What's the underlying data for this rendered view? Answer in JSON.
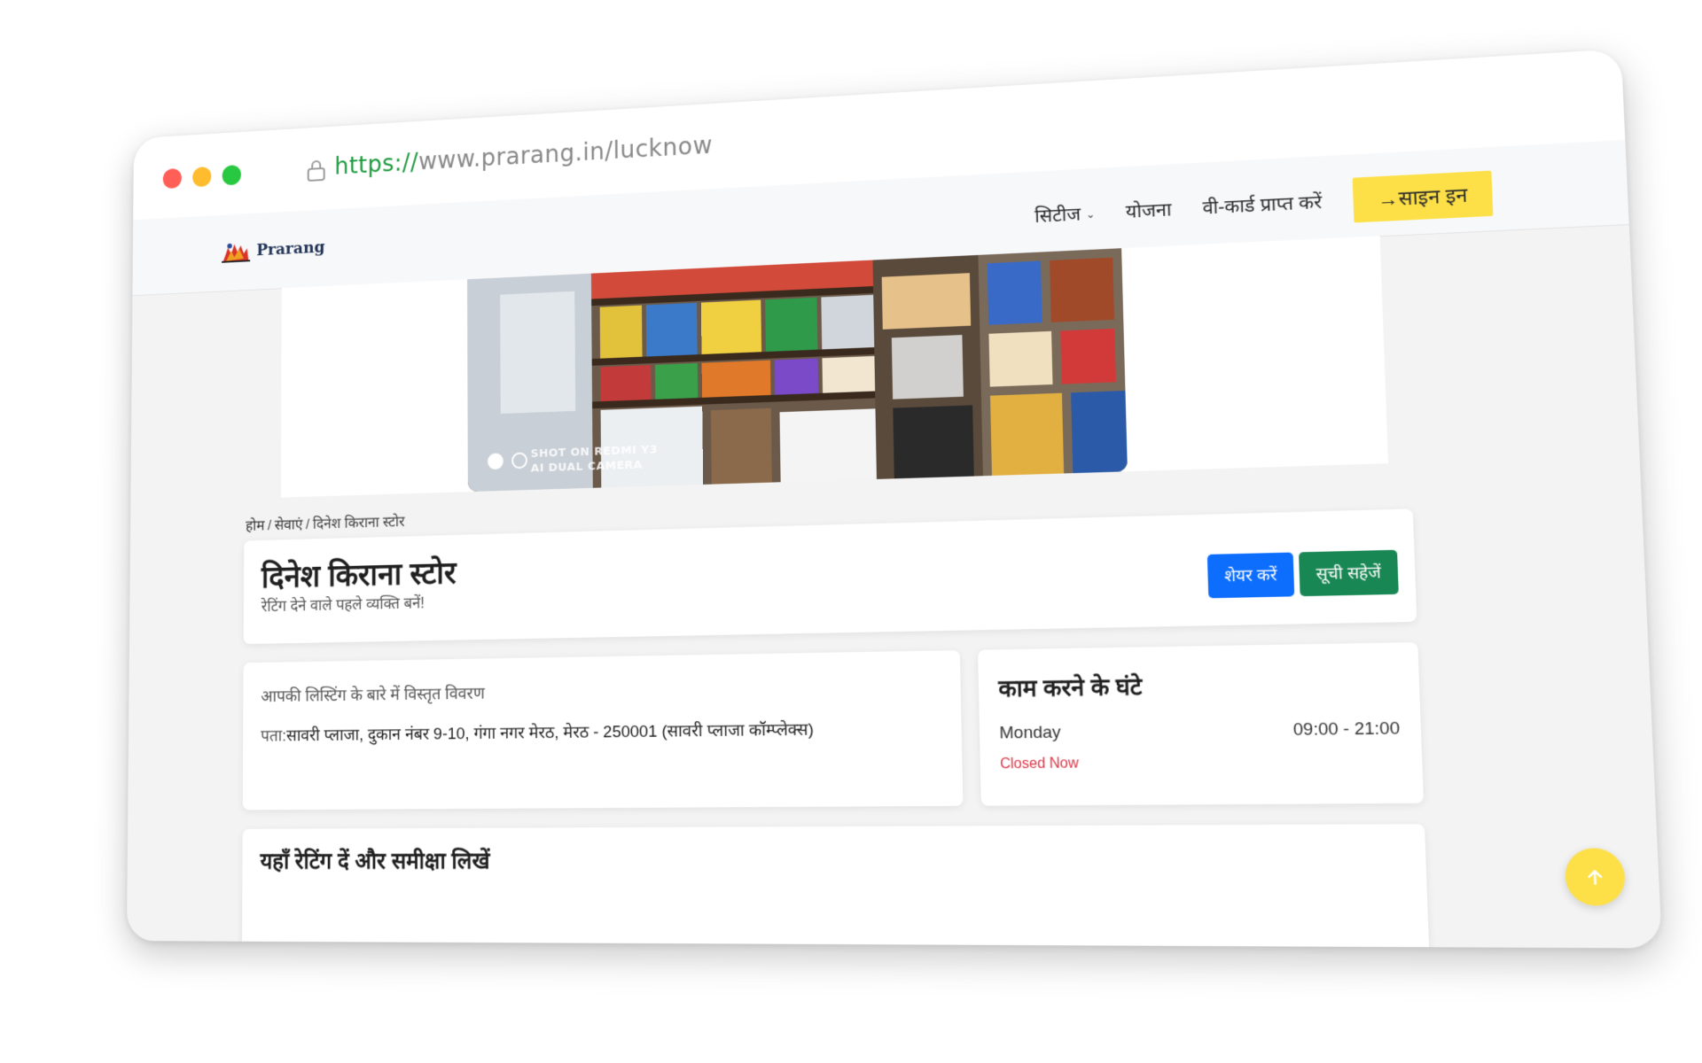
{
  "browser": {
    "url_scheme": "https://",
    "url_rest": "www.prarang.in/lucknow"
  },
  "navbar": {
    "logo_text": "Prarang",
    "items": [
      {
        "label": "सिटीज",
        "has_dropdown": true
      },
      {
        "label": "योजना"
      },
      {
        "label": "वी-कार्ड प्राप्त करें"
      }
    ],
    "signin_label": "साइन इन",
    "signin_color": "#fde047"
  },
  "hero": {
    "watermark_line1": "SHOT ON REDMI Y3",
    "watermark_line2": "AI DUAL CAMERA",
    "slide_count": 2,
    "active_slide": 1
  },
  "breadcrumb": {
    "home": "होम",
    "services": "सेवाएं",
    "current": "दिनेश किराना स्टोर",
    "separator": "/"
  },
  "listing": {
    "title": "दिनेश किराना स्टोर",
    "rating_prompt": "रेटिंग देने वाले पहले व्यक्ति बनें!",
    "share_label": "शेयर करें",
    "save_label": "सूची सहेजें",
    "share_color": "#0d6efd",
    "save_color": "#198754"
  },
  "description": {
    "heading": "आपकी लिस्टिंग के बारे में विस्तृत विवरण",
    "address_label": "पता:",
    "address": "सावरी प्लाजा, दुकान नंबर 9-10, गंगा नगर मेरठ, मेरठ - 250001 (सावरी प्लाजा कॉम्प्लेक्स)"
  },
  "hours": {
    "title": "काम करने के घंटे",
    "day": "Monday",
    "time": "09:00 - 21:00",
    "status": "Closed Now",
    "status_color": "#dc3545"
  },
  "review": {
    "title": "यहाँ रेटिंग दें और समीक्षा लिखें"
  },
  "scroll_top": {
    "icon": "arrow-up-icon",
    "color": "#fde047"
  }
}
